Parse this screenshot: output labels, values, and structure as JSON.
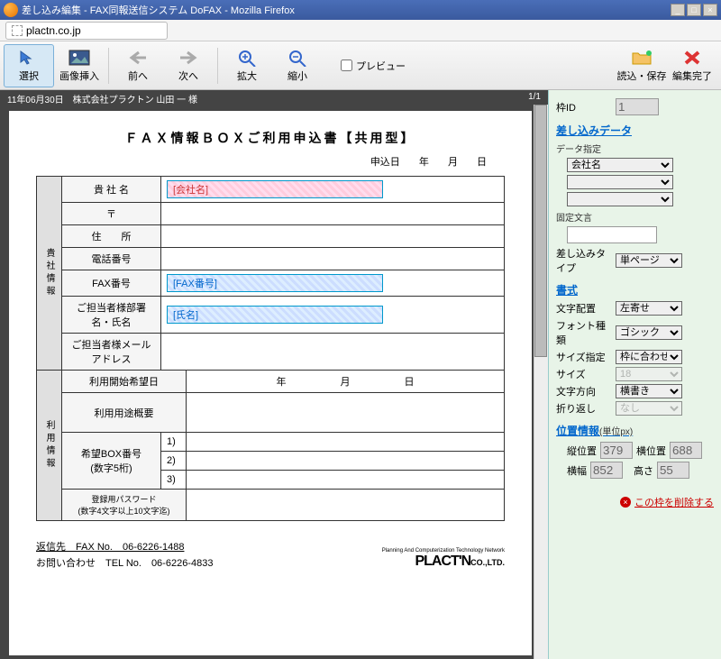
{
  "window": {
    "title": "差し込み編集 - FAX同報送信システム DoFAX - Mozilla Firefox",
    "url": "plactn.co.jp"
  },
  "toolbar": {
    "select": "選択",
    "insert_image": "画像挿入",
    "prev": "前へ",
    "next": "次へ",
    "zoom_in": "拡大",
    "zoom_out": "縮小",
    "preview": "プレビュー",
    "load_save": "読込・保存",
    "finish": "編集完了"
  },
  "docheader": {
    "left": "11年06月30日　株式会社プラクトン 山田 一 様",
    "right": "1/1"
  },
  "document": {
    "title": "ＦＡＸ情報ＢＯＸご利用申込書【共用型】",
    "date_label": "申込日",
    "year": "年",
    "month": "月",
    "day": "日",
    "section1": "貴社情報",
    "section2": "利用情報",
    "rows": {
      "company": "貴 社 名",
      "postal": "〒",
      "address": "住　　所",
      "tel": "電話番号",
      "fax": "FAX番号",
      "contact": "ご担当者様部署名・氏名",
      "email": "ご担当者様メールアドレス",
      "start": "利用開始希望日",
      "purpose": "利用用途概要",
      "box": "希望BOX番号\n(数字5桁)",
      "box1": "1)",
      "box2": "2)",
      "box3": "3)",
      "password": "登録用パスワード\n(数字4文字以上10文字迄)"
    },
    "merge": {
      "company": "[会社名]",
      "fax": "[FAX番号]",
      "name": "[氏名]"
    },
    "footer": {
      "reply": "返信先　FAX No.　06-6226-1488",
      "contact": "お問い合わせ　TEL No.　06-6226-4833",
      "logotag": "Planning And Computerization Technology Network",
      "logo": "PLACT'N",
      "logosuffix": "CO.,LTD."
    }
  },
  "side": {
    "frame_id_label": "枠ID",
    "frame_id": "1",
    "h_data": "差し込みデータ",
    "data_spec": "データ指定",
    "data_select": "会社名",
    "fixed_text": "固定文言",
    "merge_type_label": "差し込みタイプ",
    "merge_type": "単ページ",
    "h_format": "書式",
    "align_label": "文字配置",
    "align": "左寄せ",
    "font_label": "フォント種類",
    "font": "ゴシック",
    "sizemode_label": "サイズ指定",
    "sizemode": "枠に合わせる",
    "size_label": "サイズ",
    "size": "18",
    "dir_label": "文字方向",
    "dir": "横書き",
    "wrap_label": "折り返し",
    "wrap": "なし",
    "h_pos": "位置情報",
    "pos_unit": "(単位px)",
    "vpos_label": "縦位置",
    "vpos": "379",
    "hpos_label": "横位置",
    "hpos": "688",
    "w_label": "横幅",
    "w": "852",
    "h_label": "高さ",
    "h": "55",
    "delete": "この枠を削除する"
  }
}
